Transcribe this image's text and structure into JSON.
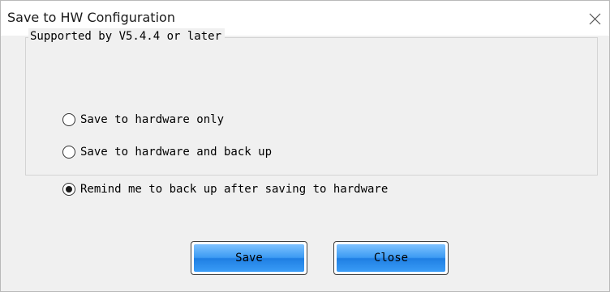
{
  "dialog": {
    "title": "Save to HW Configuration"
  },
  "group": {
    "legend": "Supported by V5.4.4 or later",
    "options": [
      {
        "label": "Save to hardware only",
        "selected": false
      },
      {
        "label": "Save to hardware and back up",
        "selected": false
      },
      {
        "label": "Remind me to back up after saving to hardware",
        "selected": true
      }
    ]
  },
  "buttons": {
    "save_label": "Save",
    "close_label": "Close"
  },
  "colors": {
    "button_gradient_top": "#7fc2ff",
    "button_gradient_bottom": "#1f7fe3",
    "dialog_background": "#f0f0f0"
  },
  "icons": {
    "close": "close-icon"
  }
}
